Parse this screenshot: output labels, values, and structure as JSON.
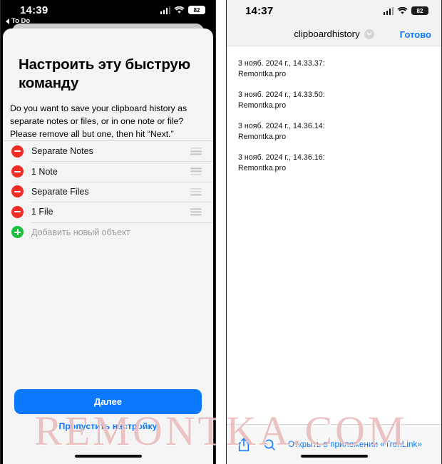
{
  "left_phone": {
    "status_bar": {
      "time": "14:39",
      "back_label": "To Do",
      "battery": "82",
      "cellular_icon": "cellular-bars-icon",
      "wifi_icon": "wifi-icon",
      "battery_icon": "battery-icon"
    },
    "sheet": {
      "title": "Настроить эту быструю команду",
      "description": "Do you want to save your clipboard history as separate notes or files, or in one note or file? Please remove all but one, then hit “Next.”",
      "rows": [
        {
          "label": "Separate Notes",
          "action": "remove",
          "handle": "drag-handle-icon"
        },
        {
          "label": "1 Note",
          "action": "remove",
          "handle": "drag-handle-icon"
        },
        {
          "label": "Separate Files",
          "action": "remove",
          "handle": "drag-handle-icon"
        },
        {
          "label": "1 File",
          "action": "remove",
          "handle": "drag-handle-icon"
        }
      ],
      "add_row": {
        "label": "Добавить новый объект",
        "action": "add"
      },
      "primary_button": "Далее",
      "skip_link": "Пропустить настройку"
    }
  },
  "right_phone": {
    "status_bar": {
      "time": "14:37",
      "battery": "82"
    },
    "nav_bar": {
      "title": "clipboardhistory",
      "chevron_icon": "chevron-down-icon",
      "done_label": "Готово"
    },
    "document": {
      "entries": [
        {
          "timestamp": "3 нояб. 2024 г., 14.33.37:",
          "text": "Remontka.pro"
        },
        {
          "timestamp": "3 нояб. 2024 г., 14.33.50:",
          "text": "Remontka.pro"
        },
        {
          "timestamp": "3 нояб. 2024 г., 14.36.14:",
          "text": "Remontka.pro"
        },
        {
          "timestamp": "3 нояб. 2024 г., 14.36.16:",
          "text": "Remontka.pro"
        }
      ]
    },
    "toolbar": {
      "share_icon": "share-icon",
      "search_icon": "search-icon",
      "open_label": "Открыть в приложении «TronLink»"
    }
  },
  "watermark": {
    "text": "REMONTKA.COM"
  },
  "colors": {
    "accent_blue": "#0a79ff",
    "remove_red": "#f02d24",
    "add_green": "#1bbf3d",
    "sheet_bg": "#f4f4f5",
    "watermark": "#d68282"
  }
}
